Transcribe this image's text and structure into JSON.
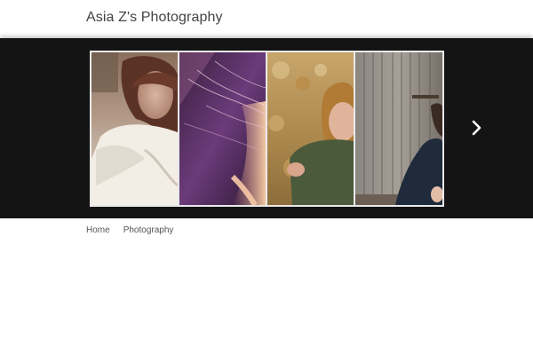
{
  "header": {
    "site_title": "Asia Z's Photography"
  },
  "slider": {
    "photos": [
      {
        "subject": "woman in white dress"
      },
      {
        "subject": "windblown hair close-up"
      },
      {
        "subject": "woman in green sweater outdoors"
      },
      {
        "subject": "figure by weathered wooden door"
      }
    ],
    "next_icon": "chevron-right-icon"
  },
  "nav": {
    "items": [
      {
        "label": "Home"
      },
      {
        "label": "Photography"
      }
    ]
  },
  "colors": {
    "slider_background": "#141414",
    "page_background": "#ffffff",
    "title_text": "#444444",
    "nav_text": "#555555"
  }
}
